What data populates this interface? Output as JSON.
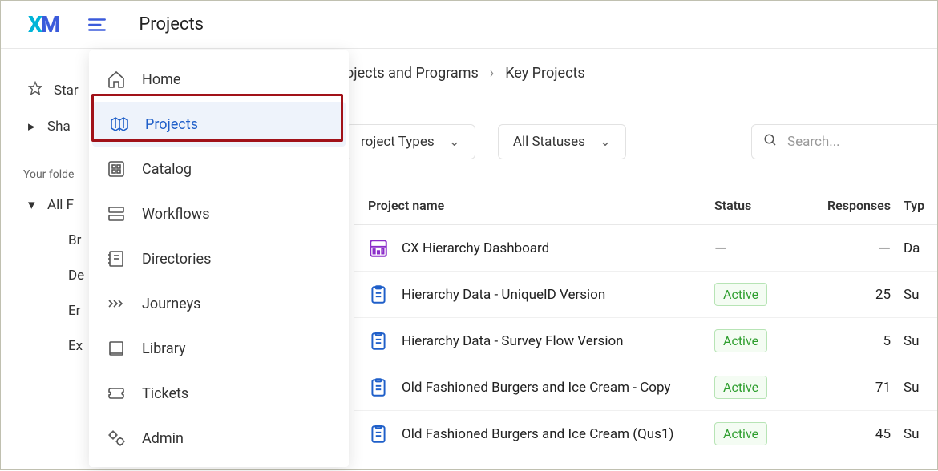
{
  "header": {
    "page_title": "Projects"
  },
  "sidebar": {
    "starred_label": "Star",
    "shared_label": "Sha",
    "folders_heading": "Your folde",
    "all_label": "All F",
    "subfolders": [
      "Br",
      "De",
      "Er",
      "Ex"
    ]
  },
  "dropdown": {
    "items": [
      {
        "label": "Home",
        "active": false
      },
      {
        "label": "Projects",
        "active": true
      },
      {
        "label": "Catalog",
        "active": false
      },
      {
        "label": "Workflows",
        "active": false
      },
      {
        "label": "Directories",
        "active": false
      },
      {
        "label": "Journeys",
        "active": false
      },
      {
        "label": "Library",
        "active": false
      },
      {
        "label": "Tickets",
        "active": false
      },
      {
        "label": "Admin",
        "active": false
      }
    ]
  },
  "breadcrumb": {
    "level1": "ojects and Programs",
    "level2": "Key Projects"
  },
  "filters": {
    "project_types_label": "roject Types",
    "all_statuses_label": "All Statuses"
  },
  "search": {
    "placeholder": "Search..."
  },
  "table": {
    "headers": {
      "name": "Project name",
      "status": "Status",
      "responses": "Responses",
      "type": "Typ"
    },
    "rows": [
      {
        "icon": "dashboard",
        "name": "CX Hierarchy Dashboard",
        "status": "—",
        "responses": "—",
        "type": "Da"
      },
      {
        "icon": "survey",
        "name": "Hierarchy Data - UniqueID Version",
        "status": "Active",
        "responses": "25",
        "type": "Su"
      },
      {
        "icon": "survey",
        "name": "Hierarchy Data - Survey Flow Version",
        "status": "Active",
        "responses": "5",
        "type": "Su"
      },
      {
        "icon": "survey",
        "name": "Old Fashioned Burgers and Ice Cream - Copy",
        "status": "Active",
        "responses": "71",
        "type": "Su"
      },
      {
        "icon": "survey",
        "name": "Old Fashioned Burgers and Ice Cream (Qus1)",
        "status": "Active",
        "responses": "45",
        "type": "Su"
      }
    ]
  }
}
